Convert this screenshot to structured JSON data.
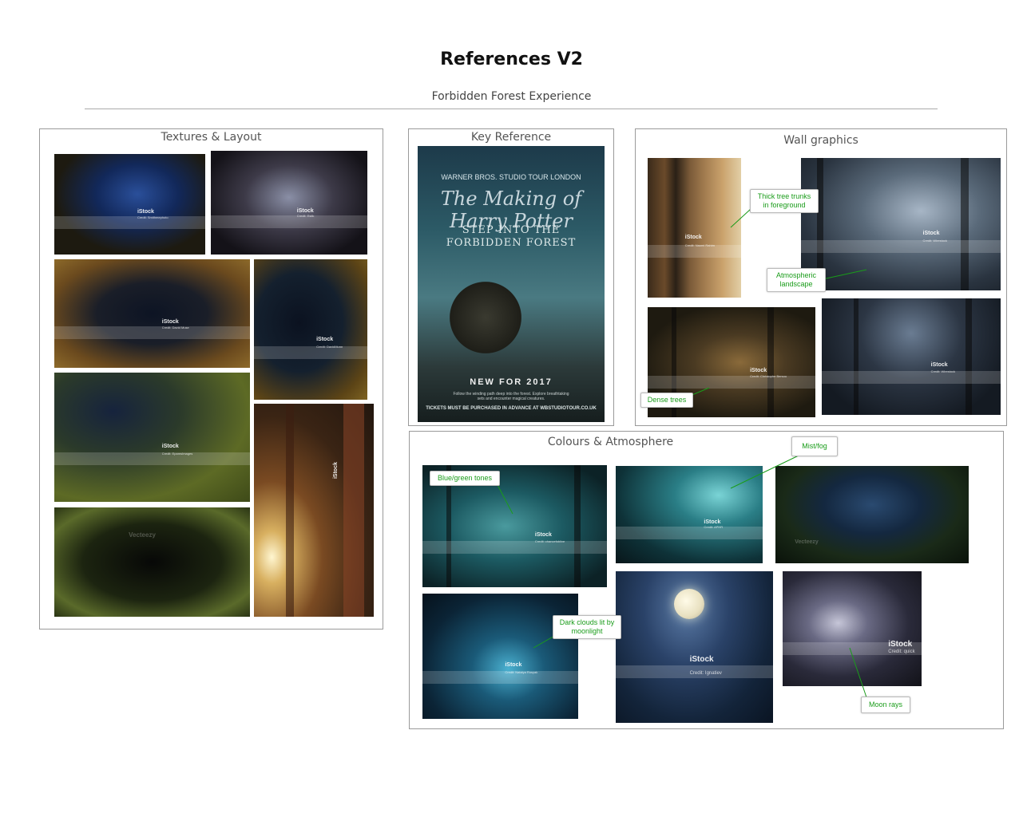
{
  "header": {
    "title": "References V2",
    "subtitle": "Forbidden Forest Experience"
  },
  "panels": {
    "textures": {
      "title": "Textures & Layout",
      "images": [
        {
          "brand": "iStock",
          "credit": "Credit: Smithmephoto"
        },
        {
          "brand": "iStock",
          "credit": "Credit: Estik"
        },
        {
          "brand": "iStock",
          "credit": "Credit: David Muse"
        },
        {
          "brand": "iStock",
          "credit": "Credit: DavidMunn"
        },
        {
          "brand": "iStock",
          "credit": "Credit: EpamsImages"
        },
        {
          "brand": "Vecteezy",
          "credit": ""
        },
        {
          "brand": "iStock",
          "credit": ""
        }
      ]
    },
    "key_reference": {
      "title": "Key Reference",
      "poster": {
        "brand": "WARNER BROS. STUDIO TOUR LONDON",
        "logo": "The Making of Harry Potter",
        "line1": "STEP INTO THE",
        "line2": "FORBIDDEN FOREST",
        "new_for": "NEW FOR 2017",
        "small": "Follow the winding path deep into the forest. Explore breathtaking sets and encounter magical creatures.",
        "url": "TICKETS MUST BE PURCHASED IN ADVANCE AT WBSTUDIOTOUR.CO.UK"
      }
    },
    "wall_graphics": {
      "title": "Wall graphics",
      "images": [
        {
          "brand": "iStock",
          "credit": "Credit: Naomi Rahim"
        },
        {
          "brand": "iStock",
          "credit": "Credit: Wirestock"
        },
        {
          "brand": "iStock",
          "credit": "Credit: Christophe Bersou"
        },
        {
          "brand": "iStock",
          "credit": "Credit: Wirestock"
        }
      ],
      "callouts": {
        "trunks": "Thick tree trunks in foreground",
        "atmospheric": "Atmospheric landscape",
        "dense": "Dense trees"
      }
    },
    "colours": {
      "title": "Colours & Atmosphere",
      "images": [
        {
          "brand": "iStock",
          "credit": "Credit: chancefoblive"
        },
        {
          "brand": "iStock",
          "credit": "Credit: APHR"
        },
        {
          "brand": "Vecteezy",
          "credit": ""
        },
        {
          "brand": "iStock",
          "credit": "Credit: Natalya Rosyak"
        },
        {
          "brand": "iStock",
          "credit": "Credit: Ignatiev"
        },
        {
          "brand": "iStock",
          "credit": "Credit: quick"
        }
      ],
      "callouts": {
        "mist": "Mist/fog",
        "blue": "Blue/green tones",
        "clouds": "Dark clouds lit by moonlight",
        "rays": "Moon rays"
      }
    }
  },
  "colors": {
    "callout_text": "#1a9c1a",
    "panel_border": "#9a9a9a",
    "rule": "#aaaaaa"
  }
}
